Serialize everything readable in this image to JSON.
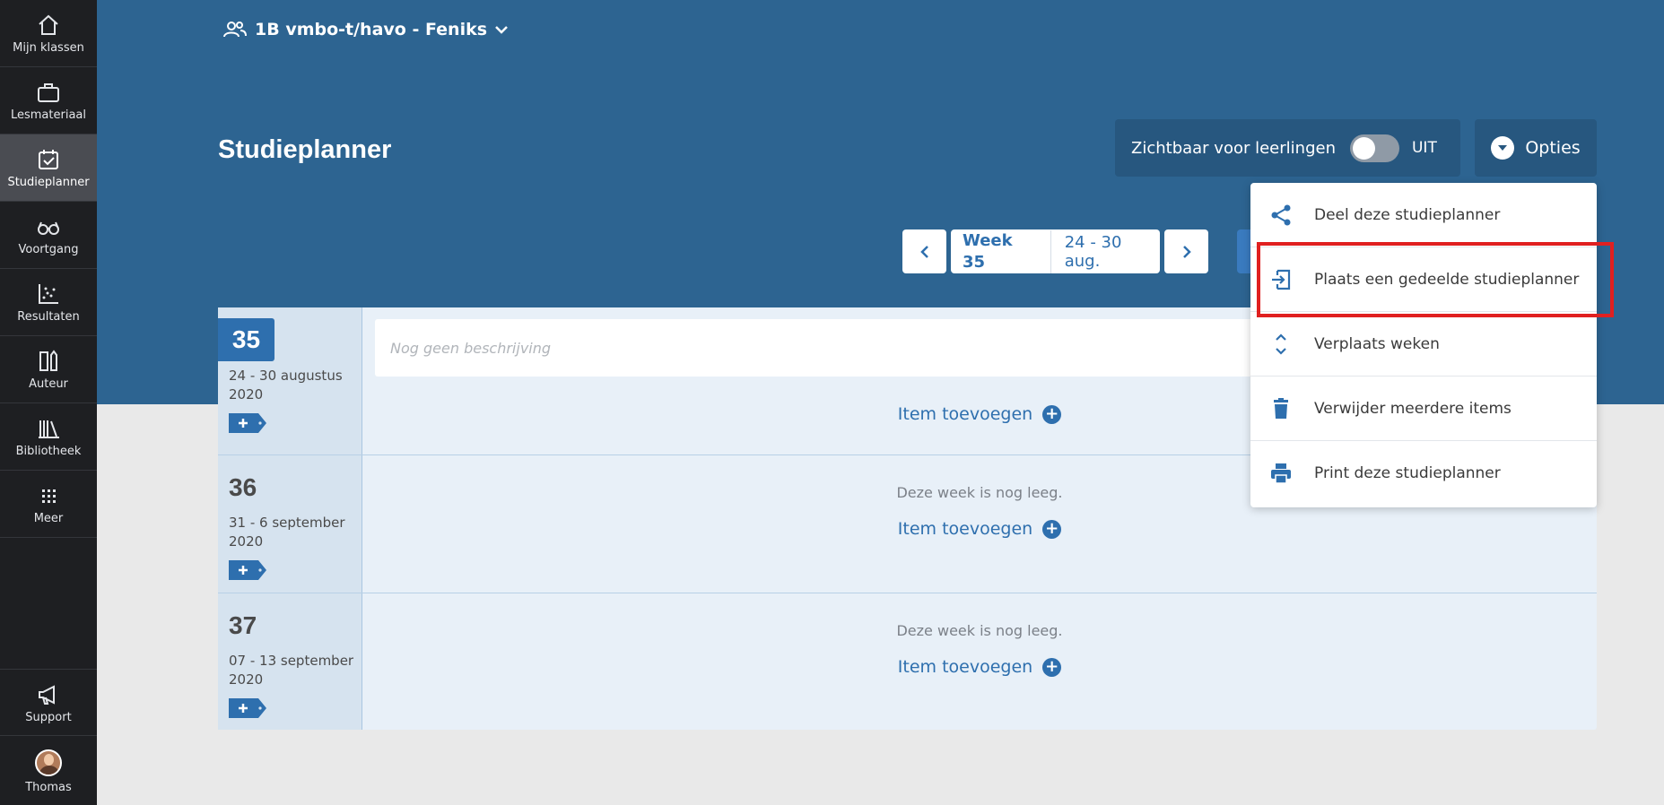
{
  "sidebar": {
    "items": [
      {
        "label": "Mijn klassen",
        "icon": "home-icon"
      },
      {
        "label": "Lesmateriaal",
        "icon": "briefcase-icon"
      },
      {
        "label": "Studieplanner",
        "icon": "calendar-check-icon",
        "active": true
      },
      {
        "label": "Voortgang",
        "icon": "glasses-icon"
      },
      {
        "label": "Resultaten",
        "icon": "scatter-chart-icon"
      },
      {
        "label": "Auteur",
        "icon": "pencil-ruler-icon"
      },
      {
        "label": "Bibliotheek",
        "icon": "books-icon"
      },
      {
        "label": "Meer",
        "icon": "grid-icon"
      }
    ],
    "support": {
      "label": "Support",
      "icon": "megaphone-icon"
    },
    "user": {
      "label": "Thomas"
    }
  },
  "header": {
    "class_name": "1B vmbo-t/havo - Feniks",
    "title": "Studieplanner",
    "visibility_label": "Zichtbaar voor leerlingen",
    "toggle_state": "UIT",
    "options_label": "Opties"
  },
  "week_nav": {
    "week": "Week 35",
    "range": "24 - 30 aug."
  },
  "weeks": [
    {
      "number": "35",
      "dates": "24 - 30 augustus 2020",
      "description_placeholder": "Nog geen beschrijving",
      "add_label": "Item toevoegen",
      "current": true
    },
    {
      "number": "36",
      "dates": "31 - 6 september 2020",
      "empty_text": "Deze week is nog leeg.",
      "add_label": "Item toevoegen"
    },
    {
      "number": "37",
      "dates": "07 - 13 september 2020",
      "empty_text": "Deze week is nog leeg.",
      "add_label": "Item toevoegen"
    }
  ],
  "options_menu": {
    "items": [
      {
        "label": "Deel deze studieplanner",
        "icon": "share-icon"
      },
      {
        "label": "Plaats een gedeelde studieplanner",
        "icon": "import-icon",
        "highlighted": true
      },
      {
        "label": "Verplaats weken",
        "icon": "move-vertical-icon"
      },
      {
        "label": "Verwijder meerdere items",
        "icon": "trash-icon"
      },
      {
        "label": "Print deze studieplanner",
        "icon": "print-icon"
      }
    ]
  },
  "colors": {
    "header_bg": "#2d6491",
    "accent": "#2e6fae",
    "sidebar_bg": "#1e1f22",
    "highlight": "#e02020"
  }
}
